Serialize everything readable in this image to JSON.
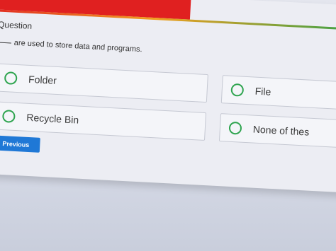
{
  "question": {
    "heading": "Question",
    "text": "are used to store data and programs."
  },
  "options": [
    {
      "label": "Folder"
    },
    {
      "label": "File"
    },
    {
      "label": "Recycle Bin"
    },
    {
      "label": "None of thes"
    }
  ],
  "nav": {
    "previous_label": "Previous"
  },
  "colors": {
    "accent": "#e02020",
    "radio": "#2ea44f",
    "button": "#1f78d6"
  }
}
